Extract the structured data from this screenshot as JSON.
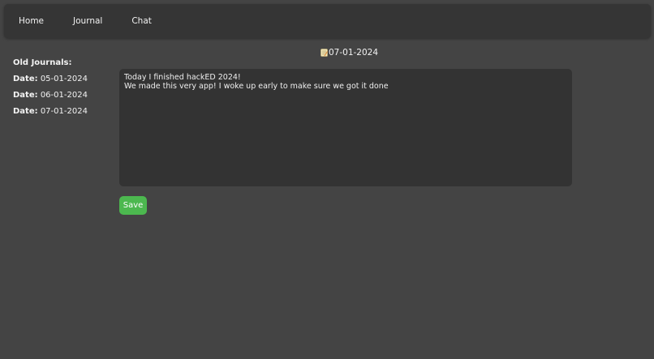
{
  "nav": {
    "items": [
      {
        "label": "Home"
      },
      {
        "label": "Journal"
      },
      {
        "label": "Chat"
      }
    ]
  },
  "sidebar": {
    "title": "Old Journals:",
    "entry_label": "Date:",
    "entries": [
      {
        "date": "05-01-2024"
      },
      {
        "date": "06-01-2024"
      },
      {
        "date": "07-01-2024"
      }
    ]
  },
  "journal": {
    "icon": "memo-icon",
    "current_date": "07-01-2024",
    "content": "Today I finished hackED 2024!\nWe made this very app! I woke up early to make sure we got it done"
  },
  "actions": {
    "save_label": "Save",
    "save_color": "#4cb84f"
  },
  "colors": {
    "background": "#444444",
    "navbar": "#353535",
    "editor": "#333333"
  }
}
